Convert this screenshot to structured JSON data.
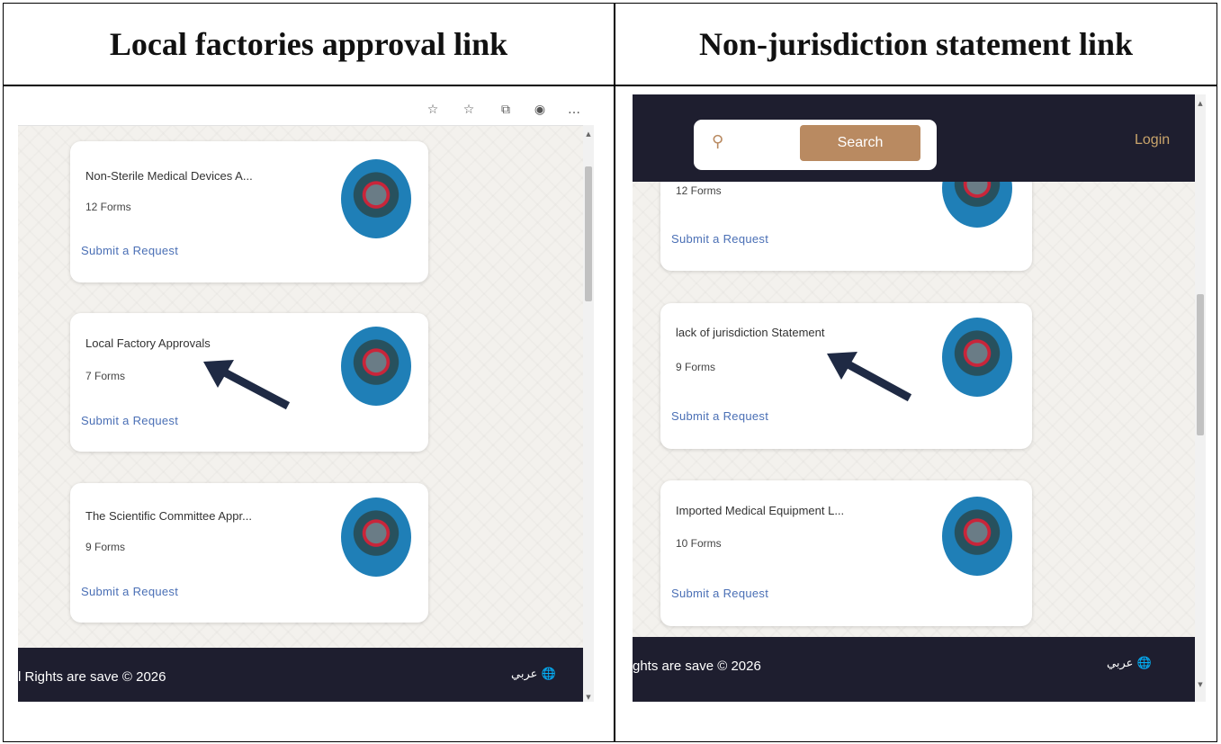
{
  "headers": {
    "left": "Local factories approval link",
    "right": "Non-jurisdiction statement link"
  },
  "left_panel": {
    "cards": [
      {
        "title": "Non-Sterile Medical Devices A...",
        "forms": "12 Forms",
        "link": "Submit a Request"
      },
      {
        "title": "Local Factory Approvals",
        "forms": "7 Forms",
        "link": "Submit a Request"
      },
      {
        "title": "The Scientific Committee Appr...",
        "forms": "9 Forms",
        "link": "Submit a Request"
      }
    ],
    "footer": {
      "copyright": "l Rights are save © 2026",
      "language": "عربي"
    }
  },
  "right_panel": {
    "search_button": "Search",
    "login": "Login",
    "cards": [
      {
        "forms": "12 Forms",
        "link": "Submit a Request"
      },
      {
        "title": "lack of jurisdiction Statement",
        "forms": "9 Forms",
        "link": "Submit a Request"
      },
      {
        "title": "Imported Medical Equipment L...",
        "forms": "10 Forms",
        "link": "Submit a Request"
      }
    ],
    "footer": {
      "copyright": "ghts are save © 2026",
      "language": "عربي"
    }
  },
  "colors": {
    "nav_bg": "#1e1e2f",
    "search_button": "#b98a61",
    "login": "#c9a46b",
    "link": "#4a6fb5",
    "arrow": "#1f2a44"
  },
  "icons": [
    "star-add-icon",
    "favorites-icon",
    "collections-icon",
    "profile-icon",
    "more-icon",
    "search-icon",
    "globe-icon"
  ]
}
